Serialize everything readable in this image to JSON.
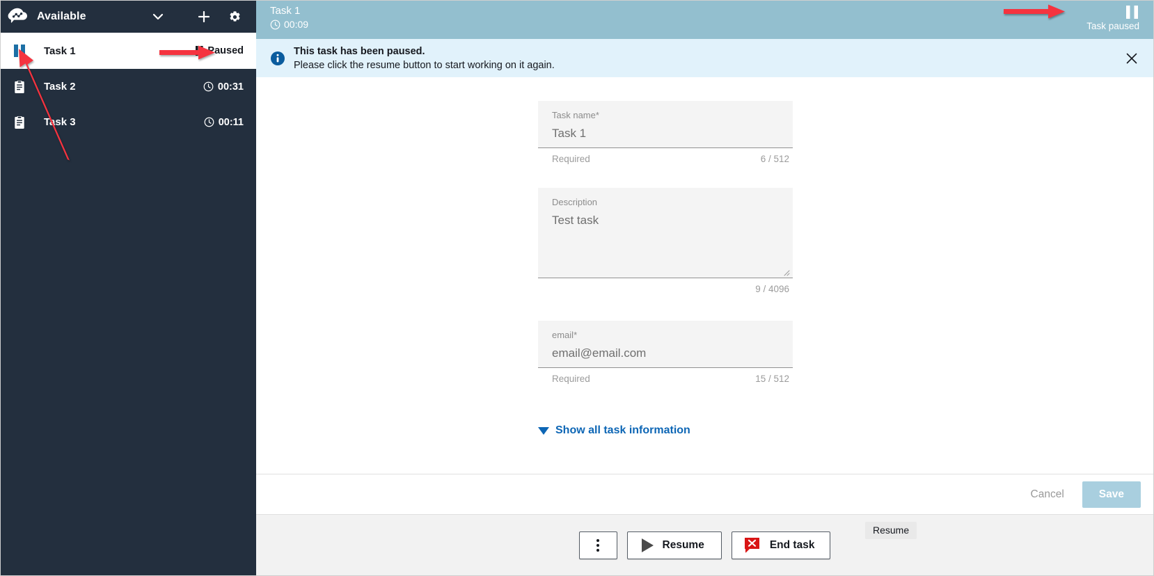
{
  "sidebar": {
    "logo_icon": "connect-cloud-logo-icon",
    "agent_status": "Available",
    "chevron_icon": "chevron-down-icon",
    "add_icon": "plus-icon",
    "settings_icon": "gear-icon",
    "tasks": [
      {
        "name": "Task 1",
        "icon": "pause-icon",
        "status_icon": "pause-icon",
        "status": "Paused",
        "selected": true
      },
      {
        "name": "Task 2",
        "icon": "clipboard-icon",
        "status_icon": "clock-icon",
        "status": "00:31",
        "selected": false
      },
      {
        "name": "Task 3",
        "icon": "clipboard-icon",
        "status_icon": "clock-icon",
        "status": "00:11",
        "selected": false
      }
    ]
  },
  "task_header": {
    "title": "Task 1",
    "timer_icon": "clock-icon",
    "timer": "00:09",
    "pause_icon": "pause-icon",
    "pause_label": "Task paused",
    "background_color": "#93bfcf"
  },
  "banner": {
    "icon": "info-circle-icon",
    "title": "This task has been paused.",
    "subtitle": "Please click the resume button to start working on it again.",
    "close_icon": "close-icon",
    "background_color": "#e1f2fb"
  },
  "form": {
    "fields": [
      {
        "label": "Task name*",
        "value": "Task 1",
        "required_text": "Required",
        "counter": "6 / 512",
        "type": "text"
      },
      {
        "label": "Description",
        "value": "Test task",
        "required_text": "",
        "counter": "9 / 4096",
        "type": "textarea"
      },
      {
        "label": "email*",
        "value": "email@email.com",
        "required_text": "Required",
        "counter": "15 / 512",
        "type": "text"
      }
    ],
    "show_all_label": "Show all task information",
    "show_all_caret_icon": "caret-down-icon",
    "link_color": "#0d66b5"
  },
  "save_bar": {
    "cancel_label": "Cancel",
    "save_label": "Save",
    "save_disabled_color": "#a9cfdf"
  },
  "action_bar": {
    "tooltip": "Resume",
    "more_icon": "kebab-menu-icon",
    "resume_icon": "play-icon",
    "resume_label": "Resume",
    "end_task_icon": "end-chat-x-icon",
    "end_task_label": "End task"
  },
  "annotations": {
    "arrow_color": "#f5333f"
  }
}
